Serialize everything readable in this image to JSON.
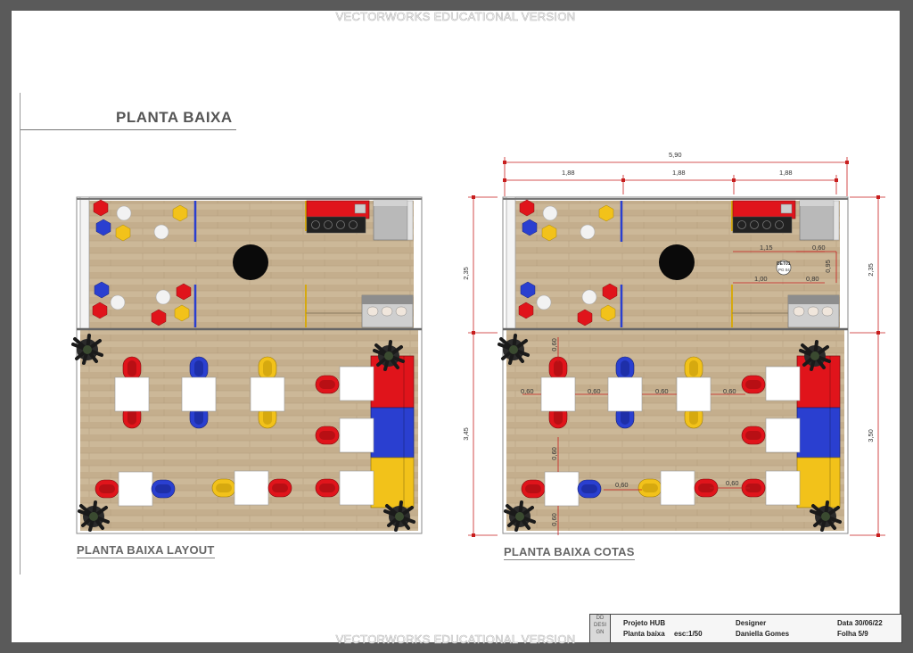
{
  "watermark": "VECTORWORKS EDUCATIONAL VERSION",
  "sheet_title": "PLANTA BAIXA",
  "layout_label": "PLANTA BAIXA LAYOUT",
  "dims_label": "PLANTA BAIXA COTAS",
  "dims": {
    "total_width": "5,90",
    "segment_1": "1,88",
    "segment_2": "1,88",
    "segment_3": "1,88",
    "left_upper": "2,35",
    "left_lower": "3,45",
    "right_upper": "2,35",
    "right_lower": "3,50",
    "gap_060": "0,60",
    "gap_115": "1,15",
    "gap_100": "1,00",
    "gap_080": "0,80",
    "gap_095": "0,95",
    "detail_tag_1": "DET01",
    "detail_tag_2": "PG 04"
  },
  "title_block": {
    "logo": "DD DESI GN",
    "project": "Projeto HUB",
    "drawing": "Planta baixa",
    "scale": "esc:1/50",
    "designer_label": "Designer",
    "designer_name": "Daniella Gomes",
    "date": "Data 30/06/22",
    "sheet": "Folha 5/9"
  },
  "colors": {
    "floor": "#c9b495",
    "red": "#e0141b",
    "blue": "#2a3fd0",
    "yellow": "#f2c21a",
    "dim_line": "#c81e1e",
    "wall": "#dcdcdc"
  }
}
